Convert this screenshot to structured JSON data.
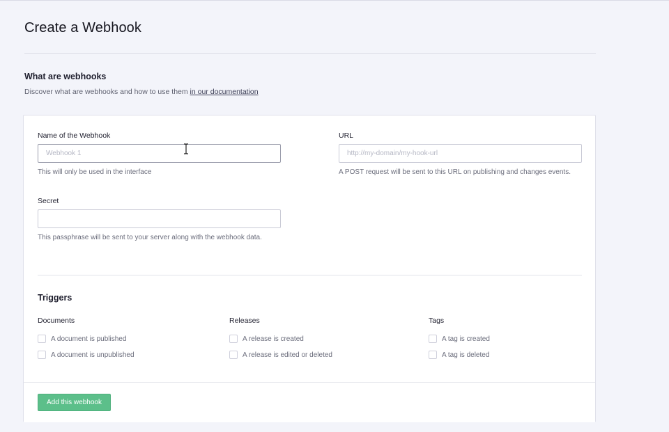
{
  "page": {
    "title": "Create a Webhook"
  },
  "intro": {
    "heading": "What are webhooks",
    "description": "Discover what are webhooks and how to use them ",
    "link_text": "in our documentation"
  },
  "form": {
    "name": {
      "label": "Name of the Webhook",
      "placeholder": "Webhook 1",
      "value": "",
      "help": "This will only be used in the interface"
    },
    "url": {
      "label": "URL",
      "placeholder": "http://my-domain/my-hook-url",
      "value": "",
      "help": "A POST request will be sent to this URL on publishing and changes events."
    },
    "secret": {
      "label": "Secret",
      "placeholder": "",
      "value": "",
      "help": "This passphrase will be sent to your server along with the webhook data."
    }
  },
  "triggers": {
    "heading": "Triggers",
    "groups": [
      {
        "title": "Documents",
        "options": [
          {
            "label": "A document is published",
            "checked": false
          },
          {
            "label": "A document is unpublished",
            "checked": false
          }
        ]
      },
      {
        "title": "Releases",
        "options": [
          {
            "label": "A release is created",
            "checked": false
          },
          {
            "label": "A release is edited or deleted",
            "checked": false
          }
        ]
      },
      {
        "title": "Tags",
        "options": [
          {
            "label": "A tag is created",
            "checked": false
          },
          {
            "label": "A tag is deleted",
            "checked": false
          }
        ]
      }
    ]
  },
  "footer": {
    "submit_label": "Add this webhook"
  },
  "colors": {
    "background": "#f3f4fa",
    "card": "#ffffff",
    "primary_button": "#5cbf8a",
    "link": "#3b3d55"
  },
  "icons": {
    "text_cursor": "i-beam-cursor-icon"
  }
}
